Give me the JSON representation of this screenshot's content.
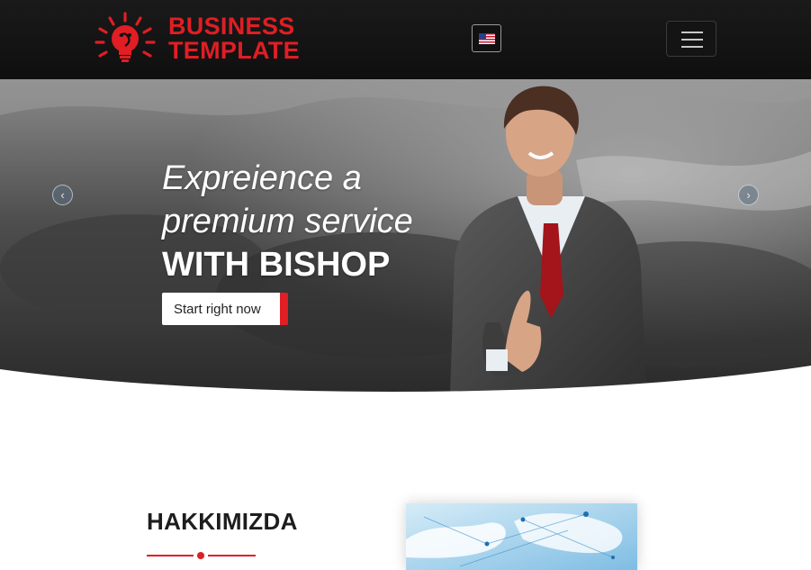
{
  "header": {
    "logo": {
      "line1": "BUSINESS",
      "line2": "TEMPLATE"
    },
    "language": {
      "icon": "us-flag-icon"
    },
    "menu": {
      "icon": "hamburger-icon"
    }
  },
  "hero": {
    "title_line1": "Expreience a",
    "title_line2": "premium service",
    "title_line3": "WITH BISHOP",
    "cta_label": "Start right now",
    "prev_icon": "chevron-left-icon",
    "next_icon": "chevron-right-icon"
  },
  "about": {
    "title": "HAKKIMIZDA"
  },
  "colors": {
    "accent": "#e01e24",
    "navbar": "#141414",
    "text_dark": "#1d1d1d"
  }
}
